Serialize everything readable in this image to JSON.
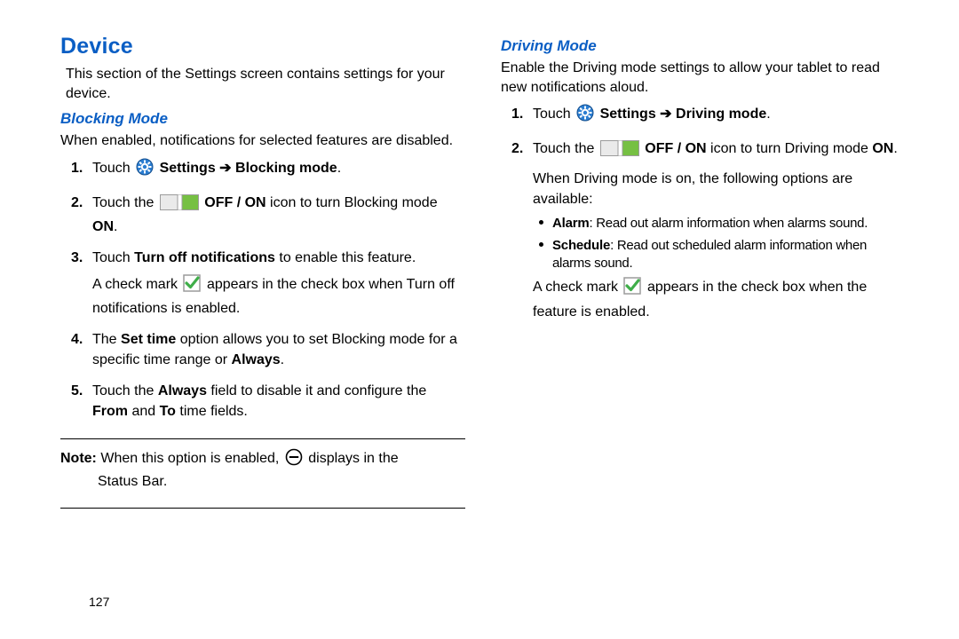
{
  "page_number": "127",
  "left": {
    "h1": "Device",
    "intro": "This section of the Settings screen contains settings for your device.",
    "h2": "Blocking Mode",
    "intro2": "When enabled, notifications for selected features are disabled.",
    "s1_a": "Touch ",
    "s1_b": " Settings ➔ Blocking mode",
    "s1_c": ".",
    "s2_a": "Touch the ",
    "s2_b": " OFF / ON",
    "s2_c": " icon to turn Blocking mode ",
    "s2_d": "ON",
    "s2_e": ".",
    "s3_a": "Touch ",
    "s3_b": "Turn off notifications",
    "s3_c": " to enable this feature.",
    "s3_sub_a": "A check mark ",
    "s3_sub_b": " appears in the check box when Turn off notifications is enabled.",
    "s4_a": "The ",
    "s4_b": "Set time",
    "s4_c": " option allows you to set Blocking mode for a specific time range or ",
    "s4_d": "Always",
    "s4_e": ".",
    "s5_a": "Touch the ",
    "s5_b": "Always",
    "s5_c": " field to disable it and configure the ",
    "s5_d": "From",
    "s5_e": " and ",
    "s5_f": "To",
    "s5_g": " time fields.",
    "note_a": "Note:",
    "note_b": " When this option is enabled, ",
    "note_c": " displays in the",
    "note_d": "Status Bar."
  },
  "right": {
    "h2": "Driving Mode",
    "intro": "Enable the Driving mode settings to allow your tablet to read new notifications aloud.",
    "s1_a": "Touch ",
    "s1_b": " Settings ➔ Driving mode",
    "s1_c": ".",
    "s2_a": "Touch the ",
    "s2_b": " OFF / ON",
    "s2_c": " icon to turn Driving mode ",
    "s2_d": "ON",
    "s2_e": ".",
    "s2_sub": "When Driving mode is on, the following options are available:",
    "b1_a": "Alarm",
    "b1_b": ": Read out alarm information when alarms sound.",
    "b2_a": "Schedule",
    "b2_b": ": Read out scheduled alarm information when alarms sound.",
    "tail_a": "A check mark ",
    "tail_b": " appears in the check box when the feature is enabled."
  }
}
